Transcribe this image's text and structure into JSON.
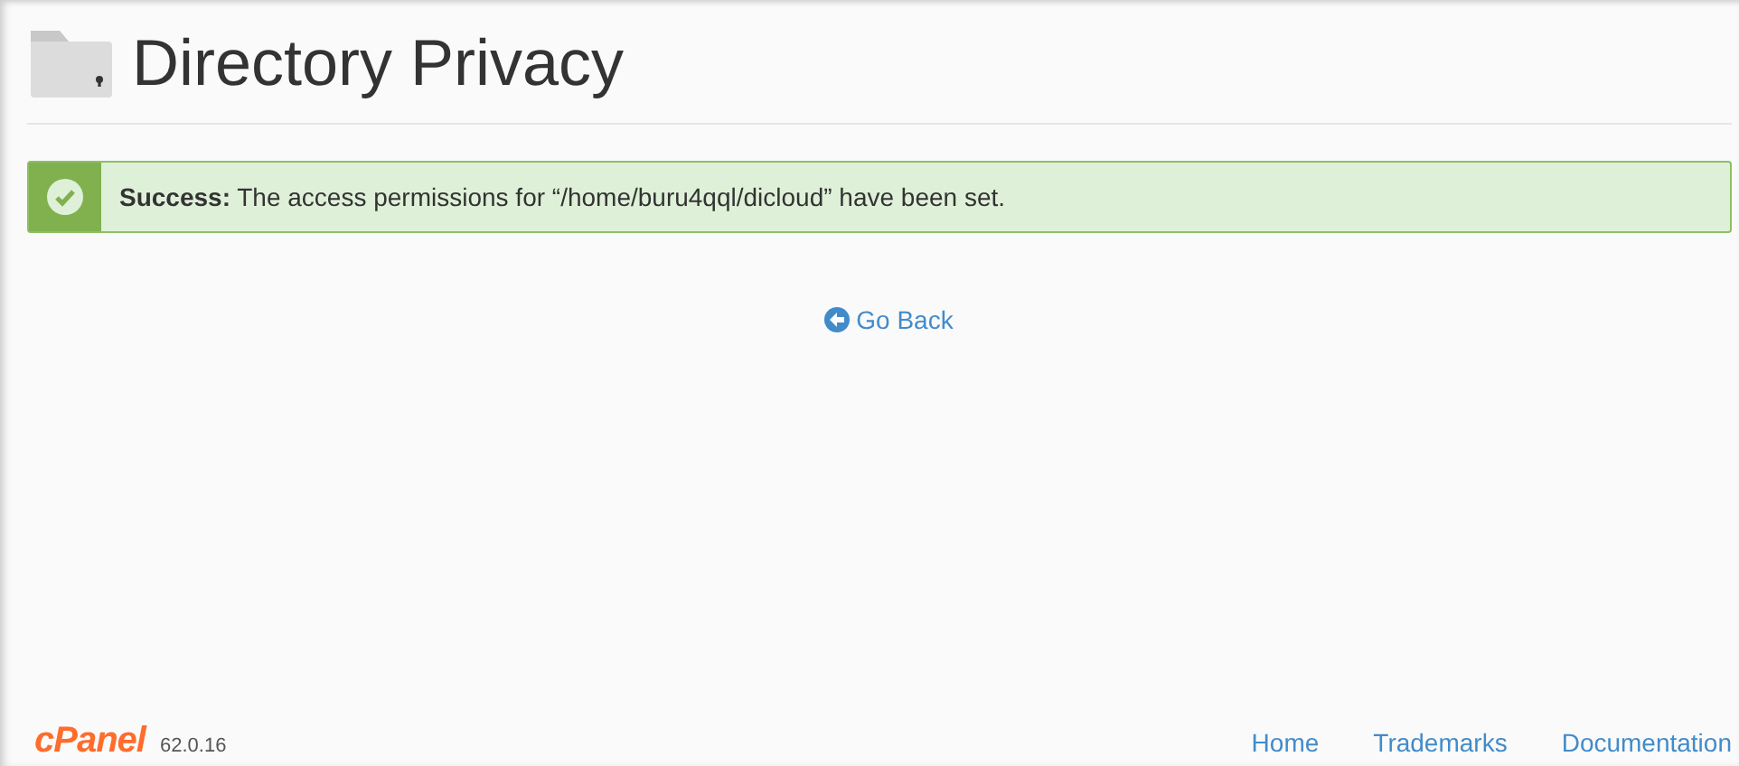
{
  "page": {
    "title": "Directory Privacy"
  },
  "alert": {
    "kind": "success",
    "label": "Success:",
    "message": "The access permissions for “/home/buru4qql/dicloud” have been set."
  },
  "back_link": {
    "label": "Go Back"
  },
  "footer": {
    "logo": "cPanel",
    "version": "62.0.16",
    "links": [
      "Home",
      "Trademarks",
      "Documentation"
    ]
  }
}
